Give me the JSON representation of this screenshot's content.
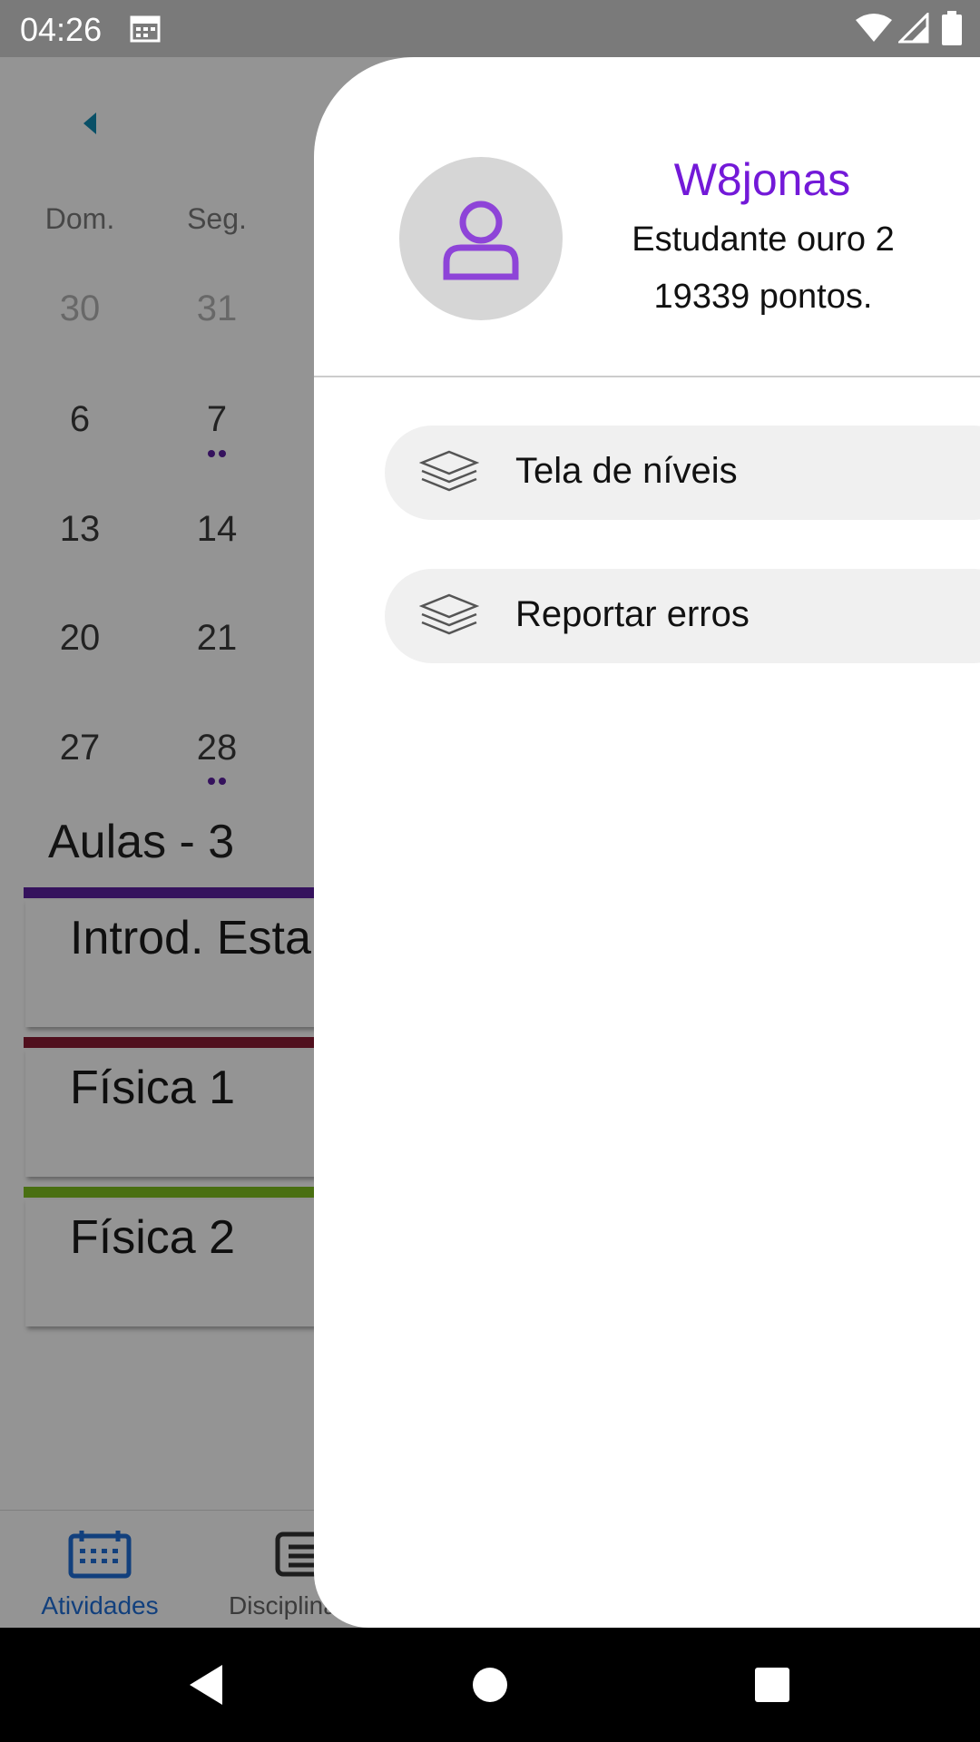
{
  "status_bar": {
    "time": "04:26"
  },
  "calendar": {
    "day_names": [
      "Dom.",
      "Seg."
    ],
    "rows": [
      [
        "30",
        "31"
      ],
      [
        "6",
        "7"
      ],
      [
        "13",
        "14"
      ],
      [
        "20",
        "21"
      ],
      [
        "27",
        "28"
      ]
    ]
  },
  "classes": {
    "title": "Aulas - 3",
    "items": [
      {
        "label": "Introd. Esta",
        "color": "#5c1fa0"
      },
      {
        "label": "Física 1",
        "color": "#8a1a32"
      },
      {
        "label": "Física 2",
        "color": "#7fbf1e"
      }
    ]
  },
  "bottom_nav": {
    "items": [
      {
        "label": "Atividades",
        "icon": "calendar-icon",
        "active_color": "#1f6fd8"
      },
      {
        "label": "Disciplina",
        "icon": "list-icon"
      }
    ]
  },
  "drawer": {
    "username": "W8jonas",
    "rank": "Estudante ouro 2",
    "points": "19339 pontos.",
    "accent": "#7319d8",
    "menu": [
      {
        "label": "Tela de níveis",
        "icon": "layers-icon"
      },
      {
        "label": "Reportar erros",
        "icon": "layers-icon"
      }
    ]
  }
}
